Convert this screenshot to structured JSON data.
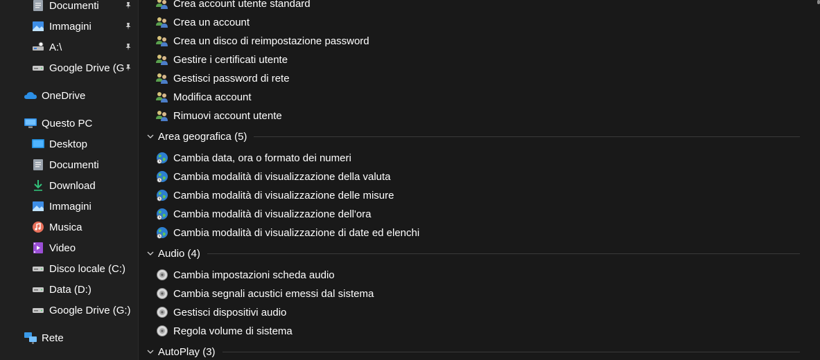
{
  "nav": {
    "items": [
      {
        "label": "Documenti",
        "icon": "documents-icon",
        "pinned": true
      },
      {
        "label": "Immagini",
        "icon": "pictures-icon",
        "pinned": true
      },
      {
        "label": "A:\\",
        "icon": "network-drive-icon",
        "pinned": true
      },
      {
        "label": "Google Drive (G",
        "icon": "drive-icon",
        "pinned": true
      },
      {
        "label": "OneDrive",
        "icon": "onedrive-icon",
        "pinned": false
      },
      {
        "label": "Questo PC",
        "icon": "this-pc-icon",
        "pinned": false
      },
      {
        "label": "Desktop",
        "icon": "desktop-icon",
        "pinned": false
      },
      {
        "label": "Documenti",
        "icon": "documents-icon",
        "pinned": false
      },
      {
        "label": "Download",
        "icon": "download-icon",
        "pinned": false
      },
      {
        "label": "Immagini",
        "icon": "pictures-icon",
        "pinned": false
      },
      {
        "label": "Musica",
        "icon": "music-icon",
        "pinned": false
      },
      {
        "label": "Video",
        "icon": "video-icon",
        "pinned": false
      },
      {
        "label": "Disco locale (C:)",
        "icon": "drive-icon",
        "pinned": false
      },
      {
        "label": "Data (D:)",
        "icon": "drive-icon",
        "pinned": false
      },
      {
        "label": "Google Drive (G:)",
        "icon": "drive-icon",
        "pinned": false
      },
      {
        "label": "Rete",
        "icon": "network-icon",
        "pinned": false
      }
    ]
  },
  "main": {
    "user_accounts_items": [
      "Crea account utente standard",
      "Crea un account",
      "Crea un disco di reimpostazione password",
      "Gestire i certificati utente",
      "Gestisci password di rete",
      "Modifica account",
      "Rimuovi account utente"
    ],
    "groups": [
      {
        "title": "Area geografica (5)",
        "icon": "globe-icon",
        "items": [
          "Cambia data, ora o formato dei numeri",
          "Cambia modalità di visualizzazione della valuta",
          "Cambia modalità di visualizzazione delle misure",
          "Cambia modalità di visualizzazione dell'ora",
          "Cambia modalità di visualizzazione di date ed elenchi"
        ]
      },
      {
        "title": "Audio (4)",
        "icon": "speaker-icon",
        "items": [
          "Cambia impostazioni scheda audio",
          "Cambia segnali acustici emessi dal sistema",
          "Gestisci dispositivi audio",
          "Regola volume di sistema"
        ]
      },
      {
        "title": "AutoPlay (3)",
        "icon": "autoplay-icon",
        "items": []
      }
    ]
  }
}
